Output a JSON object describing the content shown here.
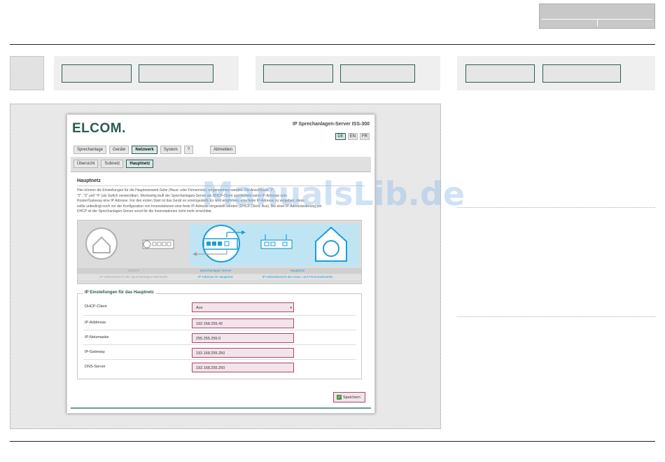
{
  "app": {
    "brand": "ELCOM.",
    "title": "IP Sprechanlagen-Server ISS-300",
    "languages": [
      {
        "code": "DE",
        "active": true
      },
      {
        "code": "EN",
        "active": false
      },
      {
        "code": "FR",
        "active": false
      }
    ]
  },
  "nav": {
    "items": [
      "Sprechanlage",
      "Geräte",
      "Netzwerk",
      "System",
      "?"
    ],
    "active": "Netzwerk",
    "logout": "Abmelden"
  },
  "subnav": {
    "items": [
      "Übersicht",
      "Subnetz",
      "Hauptnetz"
    ],
    "active": "Hauptnetz"
  },
  "page": {
    "heading": "Hauptnetz",
    "description": [
      "Hier können die Einstellungen für die Hauptnetzwerk-Seite (Haus- oder Firmennetz) vorgenommen werden. Die Anschlüsse \"1\",",
      "\"2\", \"3\" und \"4\" (als Switch verwendbar). Werkseitig läuft der Sprechanlagen-Server als DHCP-Client und bezieht seine IP-Adresse vom",
      "Router/Gateway eine IP Adresse. Für den ersten Start ist das Gerät so voreingestellt. Es wird empfohlen, eine feste IP-Adresse zu vergeben; diese",
      "sollte unbedingt noch vor der Konfiguration von Innenstationen eine feste IP-Adresse eingestellt werden (DHCP-Client: Aus). Bei einer IP-Adressänderung per",
      "DHCP ist der Sprechanlagen-Server sonst für die Innenstationen nicht mehr erreichbar."
    ]
  },
  "diagram": {
    "labels_top": [
      "Subnetz",
      "Sprechanlagen-Server",
      "Hauptnetz"
    ],
    "labels_bottom": [
      "IP-Adressbereich des Sprechanlagen-Netzwerks",
      "IP-Adresse im Hauptnetz",
      "IP-Adressbereich des Haus- und Firmennetzwerks"
    ],
    "colors": {
      "accent": "#1a9fd6",
      "muted": "#b0b0b0"
    }
  },
  "form": {
    "legend": "IP Einstellungen für das Hauptnetz",
    "fields": [
      {
        "label": "DHCP-Client",
        "value": "Aus",
        "type": "select"
      },
      {
        "label": "IP-Addresse",
        "value": "192.168.255.42",
        "type": "text"
      },
      {
        "label": "IP-Netzmaske",
        "value": "255.255.255.0",
        "type": "text"
      },
      {
        "label": "IP-Gateway",
        "value": "192.168.255.250",
        "type": "text"
      },
      {
        "label": "DNS-Server",
        "value": "192.168.255.250",
        "type": "text"
      }
    ],
    "save_label": "Speichern"
  },
  "watermark": "ManualsLib.de"
}
